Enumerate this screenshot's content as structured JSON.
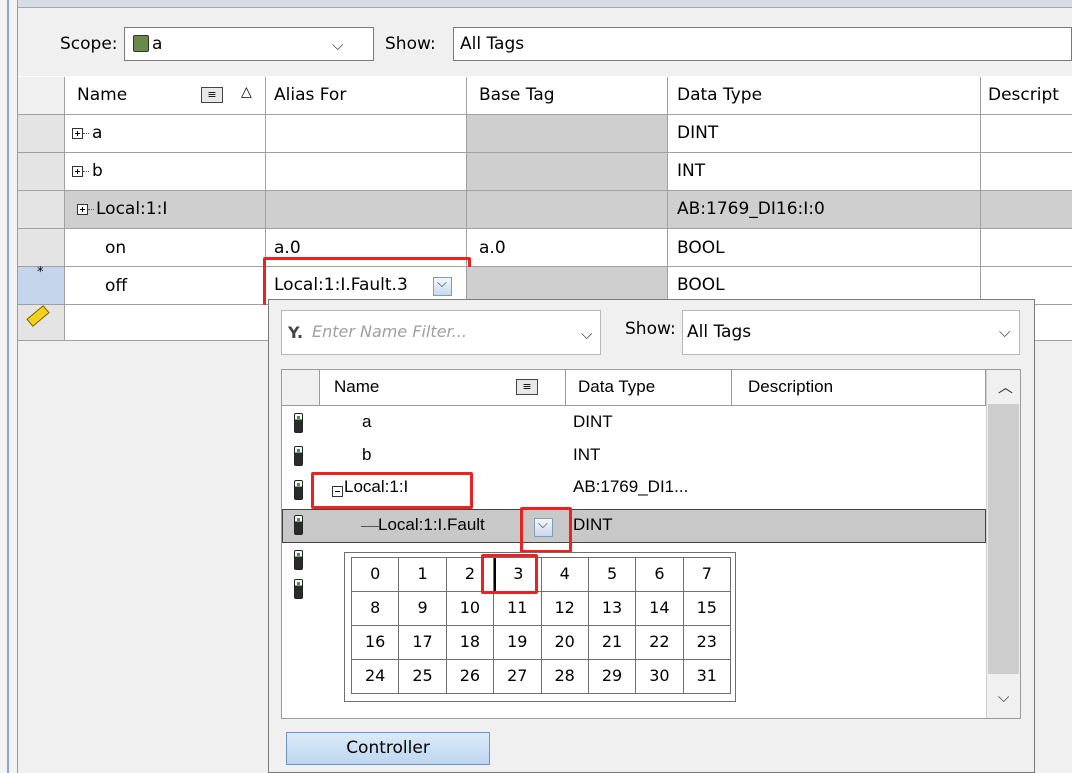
{
  "toolbar": {
    "scope_label": "Scope:",
    "scope_value": "a",
    "show_label": "Show:",
    "show_value": "All Tags"
  },
  "grid": {
    "columns": [
      "Name",
      "Alias For",
      "Base Tag",
      "Data Type",
      "Descript"
    ],
    "rows": [
      {
        "name": "a",
        "alias": "",
        "base": "",
        "type": "DINT"
      },
      {
        "name": "b",
        "alias": "",
        "base": "",
        "type": "INT"
      },
      {
        "name": "Local:1:I",
        "alias": "",
        "base": "",
        "type": "AB:1769_DI16:I:0"
      },
      {
        "name": "on",
        "alias": "a.0",
        "base": "a.0",
        "type": "BOOL"
      },
      {
        "name": "off",
        "alias": "Local:1:I.Fault.3",
        "base": "",
        "type": "BOOL"
      }
    ],
    "row_marker": "*"
  },
  "popup": {
    "filter_placeholder": "Enter Name Filter...",
    "show_label": "Show:",
    "show_value": "All Tags",
    "columns": [
      "Name",
      "Data Type",
      "Description"
    ],
    "tags": [
      {
        "name": "a",
        "type": "DINT"
      },
      {
        "name": "b",
        "type": "INT"
      },
      {
        "name": "Local:1:I",
        "type": "AB:1769_DI1..."
      },
      {
        "name": "Local:1:I.Fault",
        "type": "DINT"
      }
    ],
    "bits": [
      [
        "0",
        "1",
        "2",
        "3",
        "4",
        "5",
        "6",
        "7"
      ],
      [
        "8",
        "9",
        "10",
        "11",
        "12",
        "13",
        "14",
        "15"
      ],
      [
        "16",
        "17",
        "18",
        "19",
        "20",
        "21",
        "22",
        "23"
      ],
      [
        "24",
        "25",
        "26",
        "27",
        "28",
        "29",
        "30",
        "31"
      ]
    ],
    "controller_button": "Controller"
  }
}
